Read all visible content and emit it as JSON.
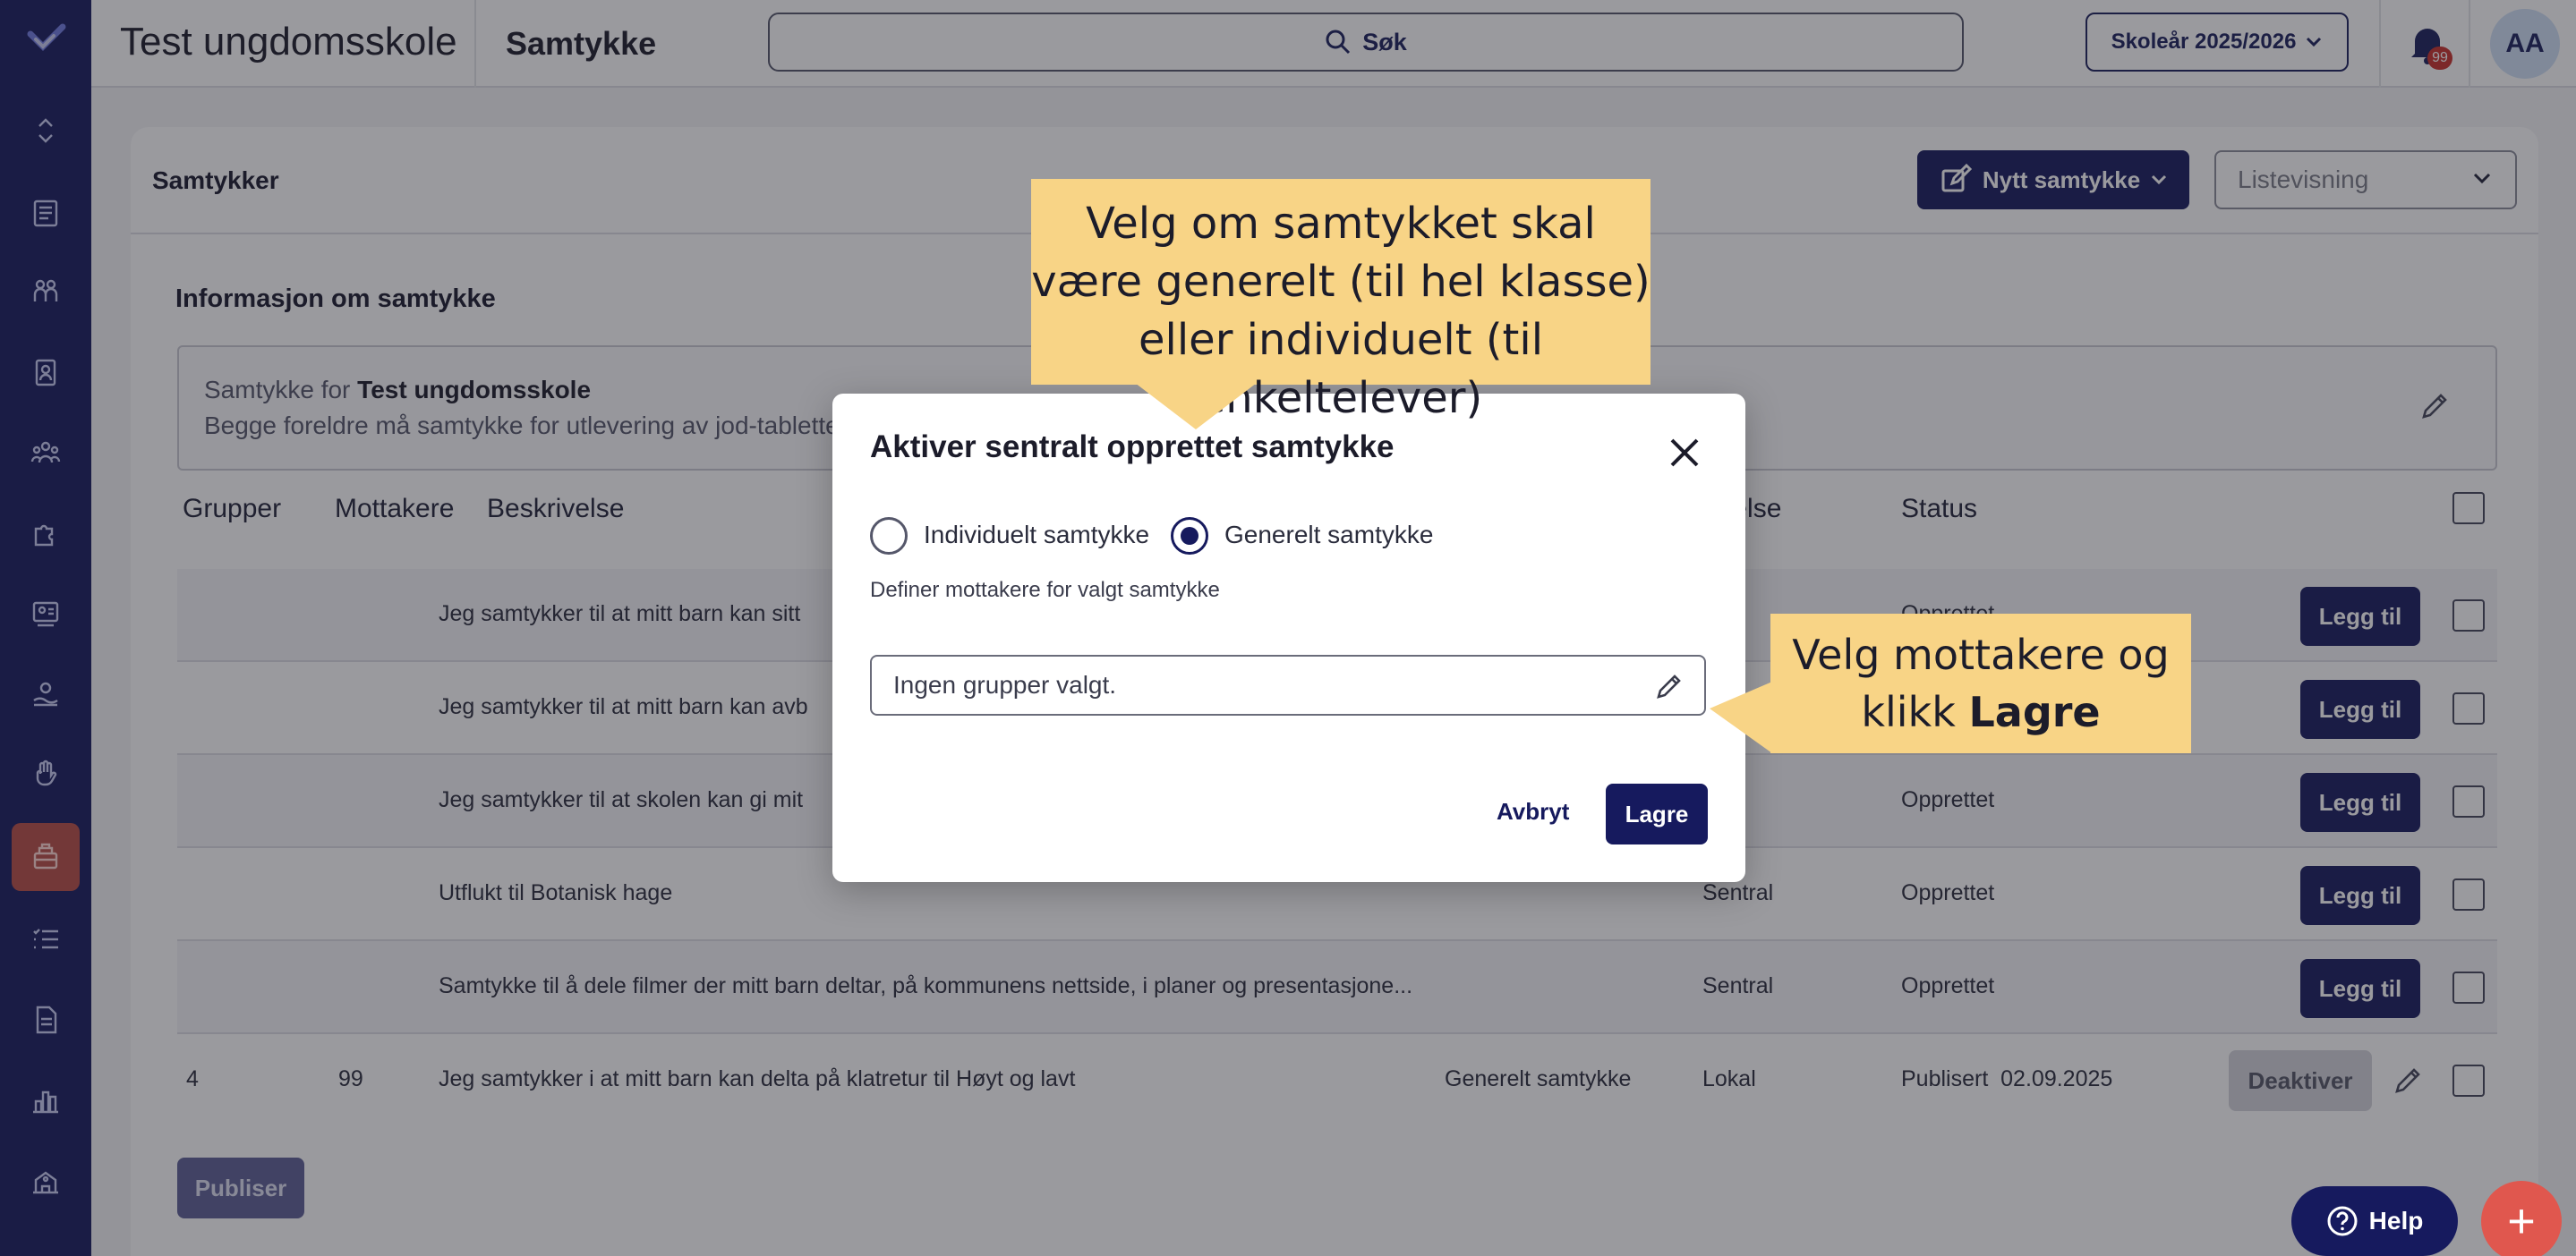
{
  "app": {
    "school_name": "Test ungdomsskole",
    "page_title": "Samtykke",
    "search_label": "Søk",
    "school_year": "Skoleår 2025/2026",
    "notification_count": "99",
    "avatar_initials": "AA"
  },
  "card": {
    "title": "Samtykker",
    "new_button": "Nytt samtykke",
    "view_select": "Listevisning",
    "info_title": "Informasjon om samtykke",
    "info_prefix": "Samtykke for ",
    "info_school": "Test ungdomsskole",
    "info_text": "Begge foreldre må samtykke for utlevering av jod-tabletter"
  },
  "table": {
    "headers": [
      "Grupper",
      "Mottakere",
      "Beskrivelse",
      "nnelse",
      "Status"
    ],
    "rows": [
      {
        "groups": "",
        "recipients": "",
        "description": "Jeg samtykker til at mitt barn kan sitt",
        "type": "",
        "origin": "",
        "status": "Opprettet",
        "action": "Legg til"
      },
      {
        "groups": "",
        "recipients": "",
        "description": "Jeg samtykker til at mitt barn kan avb",
        "type": "",
        "origin": "",
        "status": "",
        "action": "Legg til"
      },
      {
        "groups": "",
        "recipients": "",
        "description": "Jeg samtykker til at skolen kan gi mit",
        "type": "",
        "origin": "",
        "status": "Opprettet",
        "action": "Legg til"
      },
      {
        "groups": "",
        "recipients": "",
        "description": "Utflukt til Botanisk hage",
        "type": "",
        "origin": "Sentral",
        "status": "Opprettet",
        "action": "Legg til"
      },
      {
        "groups": "",
        "recipients": "",
        "description": "Samtykke til å dele filmer der mitt barn deltar, på kommunens nettside, i planer og presentasjone...",
        "type": "",
        "origin": "Sentral",
        "status": "Opprettet",
        "action": "Legg til"
      },
      {
        "groups": "4",
        "recipients": "99",
        "description": "Jeg samtykker i at mitt barn kan delta på klatretur til Høyt og lavt",
        "type": "Generelt samtykke",
        "origin": "Lokal",
        "status": "Publisert  02.09.2025",
        "action": "Deaktiver"
      }
    ],
    "publish_button": "Publiser"
  },
  "modal": {
    "title": "Aktiver sentralt opprettet samtykke",
    "radio_individual": "Individuelt samtykke",
    "radio_general": "Generelt samtykke",
    "selected": "Generelt samtykke",
    "subtitle": "Definer mottakere for valgt samtykke",
    "groups_value": "Ingen grupper valgt.",
    "cancel": "Avbryt",
    "save": "Lagre"
  },
  "callouts": {
    "top": "Velg om samtykket skal være generelt (til hel klasse) eller individuelt (til enkeltelever)",
    "right_prefix": "Velg mottakere og klikk ",
    "right_bold": "Lagre"
  },
  "floating": {
    "help": "Help",
    "fab": "+"
  },
  "colors": {
    "brand": "#161a5e",
    "active_nav": "#b84d46",
    "callout": "#f8d486",
    "fab": "#e0574e"
  }
}
